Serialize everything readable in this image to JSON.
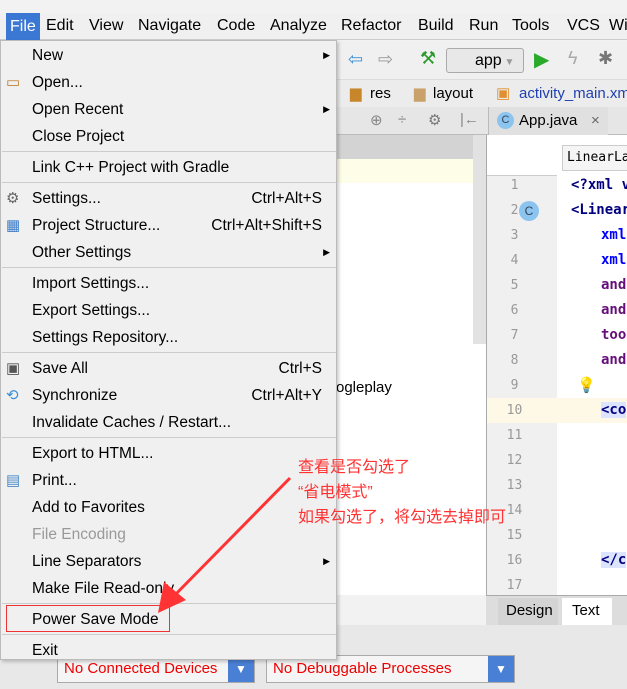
{
  "menubar": [
    "File",
    "Edit",
    "View",
    "Navigate",
    "Code",
    "Analyze",
    "Refactor",
    "Build",
    "Run",
    "Tools",
    "VCS",
    "Wi"
  ],
  "toolbar": {
    "config": "app"
  },
  "breadcrumbs": [
    "res",
    "layout",
    "activity_main.xml"
  ],
  "tabs": {
    "app_java": "App.java"
  },
  "editor": {
    "tag_tab": "LinearLayout",
    "lines": [
      "1",
      "2",
      "3",
      "4",
      "5",
      "6",
      "7",
      "8",
      "9",
      "10",
      "11",
      "12",
      "13",
      "14",
      "15",
      "16",
      "17"
    ],
    "code": [
      "<?xml v",
      "<Linear",
      "xml",
      "xml",
      "and",
      "and",
      "too",
      "and",
      "",
      "<co",
      "",
      "",
      "",
      "",
      "",
      "</c",
      ""
    ],
    "bottom_tabs": [
      "Design",
      "Text"
    ]
  },
  "left_pane": {
    "text": "ogleplay"
  },
  "file_menu": [
    {
      "label": "New",
      "submenu": true
    },
    {
      "label": "Open...",
      "icon": "folder-icon"
    },
    {
      "label": "Open Recent",
      "submenu": true
    },
    {
      "label": "Close Project"
    },
    {
      "label": "Link C++ Project with Gradle"
    },
    {
      "label": "Settings...",
      "shortcut": "Ctrl+Alt+S",
      "icon": "wrench-icon"
    },
    {
      "label": "Project Structure...",
      "shortcut": "Ctrl+Alt+Shift+S",
      "icon": "structure-icon"
    },
    {
      "label": "Other Settings",
      "submenu": true
    },
    {
      "label": "Import Settings..."
    },
    {
      "label": "Export Settings..."
    },
    {
      "label": "Settings Repository..."
    },
    {
      "label": "Save All",
      "shortcut": "Ctrl+S",
      "icon": "save-icon"
    },
    {
      "label": "Synchronize",
      "shortcut": "Ctrl+Alt+Y",
      "icon": "sync-icon"
    },
    {
      "label": "Invalidate Caches / Restart..."
    },
    {
      "label": "Export to HTML..."
    },
    {
      "label": "Print...",
      "icon": "printer-icon"
    },
    {
      "label": "Add to Favorites"
    },
    {
      "label": "File Encoding",
      "disabled": true
    },
    {
      "label": "Line Separators",
      "submenu": true
    },
    {
      "label": "Make File Read-only"
    },
    {
      "label": "Power Save Mode"
    },
    {
      "label": "Exit"
    }
  ],
  "annotation": {
    "line1": "查看是否勾选了",
    "line2": "“省电模式”",
    "line3": "如果勾选了，将勾选去掉即可",
    "color": "#ff3333"
  },
  "status": {
    "devices": "No Connected Devices",
    "processes": "No Debuggable Processes"
  }
}
